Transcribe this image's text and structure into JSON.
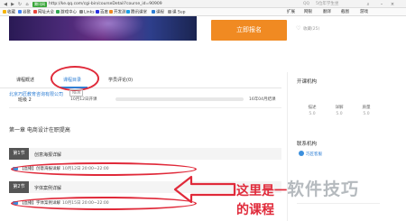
{
  "browser": {
    "site_badge": "腾讯网",
    "url": "http://ke.qq.com/cgi-bin/courseDetail?course_id=90909",
    "search_placeholder": "QQ",
    "search_hint": "5位年学生坐",
    "bookmarks": [
      "收藏",
      "谷歌",
      "网址大全",
      "游戏中心",
      "Links",
      "百度",
      "开发测",
      "腾讯课堂",
      "课程",
      "课 Sup"
    ],
    "right_tools": [
      "扩展",
      "网银",
      "翻译",
      "截图",
      "游戏"
    ]
  },
  "course": {
    "signup_label": "立即报名",
    "favorite_label": "收藏(25)",
    "tabs": [
      "课程概述",
      "课程目录",
      "学员评论(0)"
    ],
    "class_label": "班级 2",
    "start_date": "10月12日开课",
    "progress": 0.0,
    "end_date": "16年04月结课",
    "chapter_title": "第一章 电商设计在职提高",
    "sections": [
      {
        "no": "第1节",
        "title": "创意海报详解",
        "lesson_tag": "【直播】",
        "lesson_title": "创意海报详解",
        "lesson_time": "10月12日 20:00~22:00"
      },
      {
        "no": "第2节",
        "title": "字体案例详解",
        "lesson_tag": "【直播】",
        "lesson_title": "字体案例详解",
        "lesson_time": "10月15日 20:00~22:00"
      }
    ]
  },
  "sidebar": {
    "org_heading": "开课机构",
    "org_name": "北京巧匠教育咨询有限公司",
    "new_badge": "NEW",
    "scores": [
      {
        "label": "描述",
        "value": "5.0"
      },
      {
        "label": "详解",
        "value": "5.0"
      },
      {
        "label": "质量",
        "value": "5.0"
      }
    ],
    "contact_heading": "联系机构",
    "contact_link": "巧匠客服"
  },
  "annotation": {
    "line1": "这里是一",
    "line2": "的课程",
    "watermark": "软件技巧"
  },
  "colors": {
    "accent_blue": "#2f7fd4",
    "signup_orange": "#f08a22",
    "annotation_red": "#e02a3a"
  }
}
